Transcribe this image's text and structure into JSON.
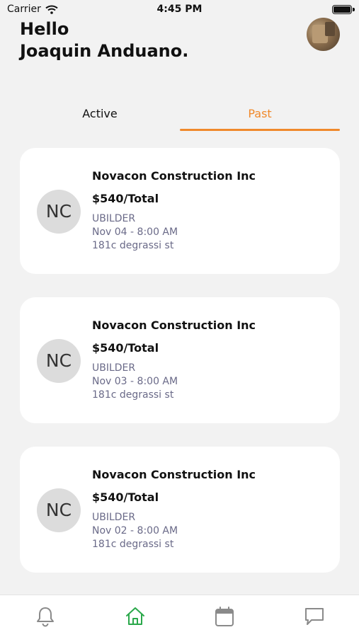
{
  "status_bar": {
    "carrier": "Carrier",
    "time": "4:45 PM"
  },
  "header": {
    "greeting_line1": "Hello",
    "greeting_line2": "Joaquin Anduano."
  },
  "tabs": [
    {
      "label": "Active",
      "selected": false
    },
    {
      "label": "Past",
      "selected": true
    }
  ],
  "accent_color": "#f0892b",
  "active_nav_color": "#2aa84a",
  "jobs": [
    {
      "initials": "NC",
      "company": "Novacon Construction Inc",
      "price": "$540/Total",
      "role": "UBILDER",
      "datetime": "Nov 04 - 8:00 AM",
      "address": "181c degrassi st"
    },
    {
      "initials": "NC",
      "company": "Novacon Construction Inc",
      "price": "$540/Total",
      "role": "UBILDER",
      "datetime": "Nov 03 - 8:00 AM",
      "address": "181c degrassi st"
    },
    {
      "initials": "NC",
      "company": "Novacon Construction Inc",
      "price": "$540/Total",
      "role": "UBILDER",
      "datetime": "Nov 02 - 8:00 AM",
      "address": "181c degrassi st"
    }
  ],
  "bottom_nav": [
    {
      "icon": "bell-icon",
      "active": false
    },
    {
      "icon": "home-icon",
      "active": true
    },
    {
      "icon": "calendar-icon",
      "active": false
    },
    {
      "icon": "chat-icon",
      "active": false
    }
  ]
}
